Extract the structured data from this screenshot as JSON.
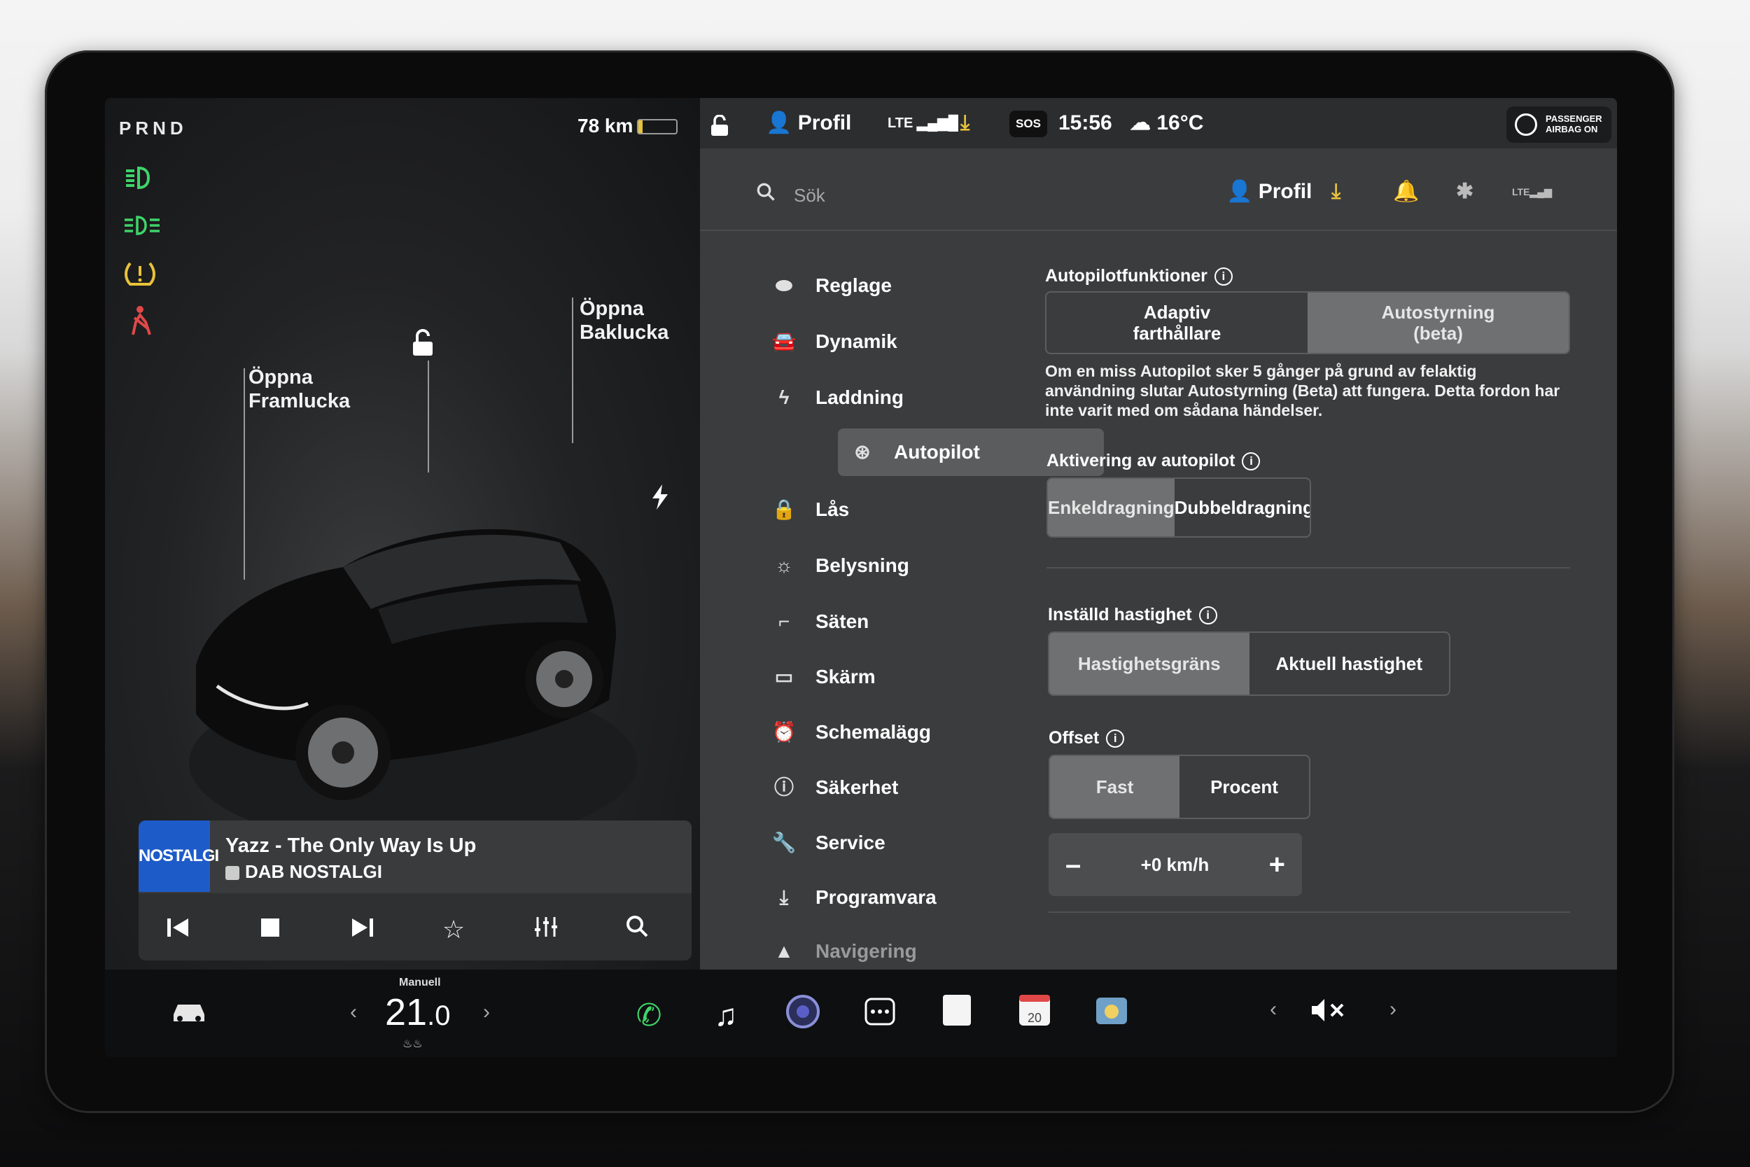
{
  "status": {
    "gear": "PRND",
    "range": "78 km",
    "profile": "Profil",
    "lte": "LTE",
    "sos": "SOS",
    "time": "15:56",
    "temp": "16°C",
    "airbag": "PASSENGER AIRBAG ON"
  },
  "left": {
    "frunk": "Öppna Framlucka",
    "trunk": "Öppna Baklucka"
  },
  "media": {
    "logo": "NOSTALGI",
    "song": "Yazz - The Only Way Is Up",
    "station": "DAB NOSTALGI"
  },
  "search": {
    "placeholder": "Sök",
    "profile": "Profil",
    "lte": "LTE"
  },
  "menu": [
    {
      "label": "Reglage",
      "icon": "toggle-icon"
    },
    {
      "label": "Dynamik",
      "icon": "car-icon"
    },
    {
      "label": "Laddning",
      "icon": "bolt-icon"
    },
    {
      "label": "Autopilot",
      "icon": "steering-icon"
    },
    {
      "label": "Lås",
      "icon": "lock-icon"
    },
    {
      "label": "Belysning",
      "icon": "sun-icon"
    },
    {
      "label": "Säten",
      "icon": "seat-icon"
    },
    {
      "label": "Skärm",
      "icon": "display-icon"
    },
    {
      "label": "Schemalägg",
      "icon": "clock-icon"
    },
    {
      "label": "Säkerhet",
      "icon": "alert-icon"
    },
    {
      "label": "Service",
      "icon": "wrench-icon"
    },
    {
      "label": "Programvara",
      "icon": "download-icon"
    },
    {
      "label": "Navigering",
      "icon": "nav-icon"
    }
  ],
  "settings": {
    "ap_title": "Autopilotfunktioner",
    "ap_opt1": "Adaptiv farthållare",
    "ap_opt2": "Autostyrning (beta)",
    "ap_desc": "Om en miss Autopilot sker 5 gånger på grund av felaktig användning slutar Autostyrning (Beta) att fungera. Detta fordon har inte varit med om sådana händelser.",
    "act_title": "Aktivering av autopilot",
    "act_opt1": "Enkeldragning",
    "act_opt2": "Dubbeldragning",
    "speed_title": "Inställd hastighet",
    "speed_opt1": "Hastighetsgräns",
    "speed_opt2": "Aktuell hastighet",
    "offset_title": "Offset",
    "offset_opt1": "Fast",
    "offset_opt2": "Procent",
    "offset_value": "+0 km/h"
  },
  "dock": {
    "climate_mode": "Manuell",
    "temp_int": "21",
    "temp_dec": ".0",
    "calendar_day": "20"
  },
  "colors": {
    "accent_green": "#3fd46a",
    "warn_yellow": "#e8c23a",
    "warn_red": "#e04848",
    "radio_blue": "#1d5bc8"
  }
}
